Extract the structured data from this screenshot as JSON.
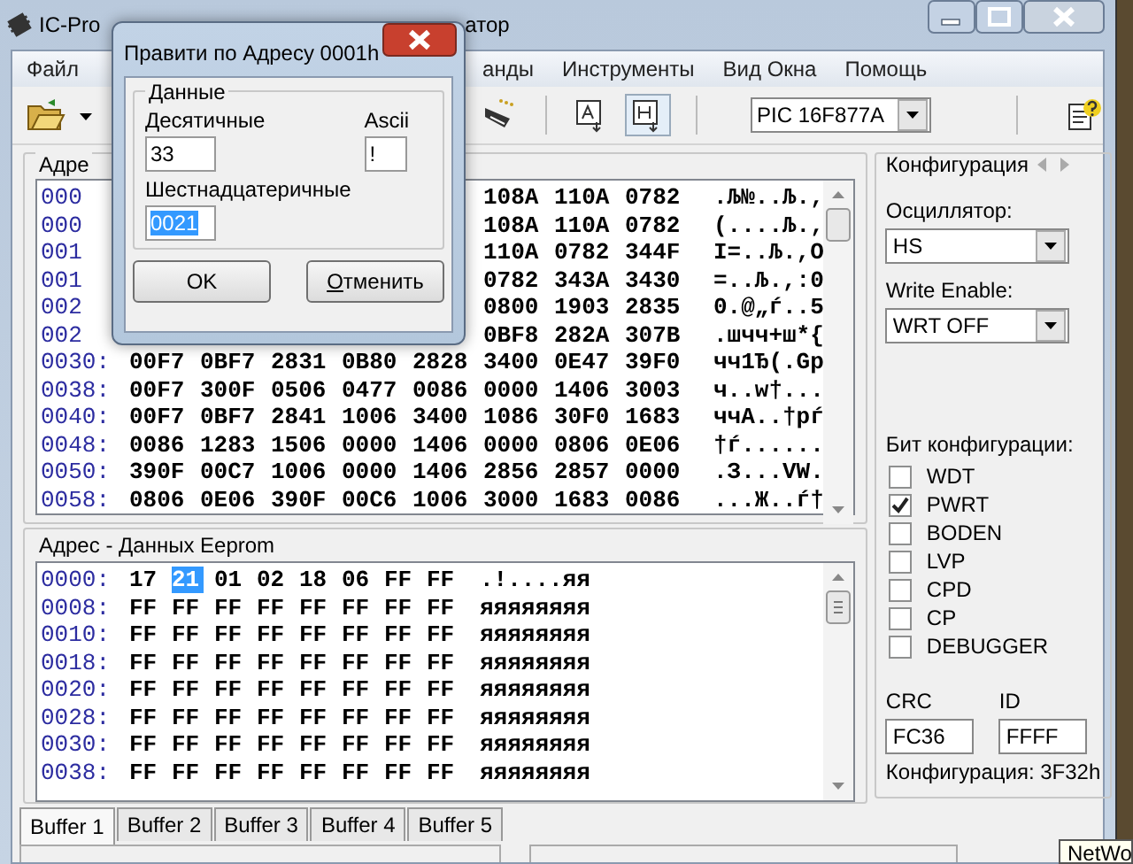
{
  "window": {
    "title_left": "IC-Pro",
    "title_right": "атор"
  },
  "menu": [
    "Файл",
    "анды",
    "Инструменты",
    "Вид Окна",
    "Помощь"
  ],
  "toolbar": {
    "device": "PIC 16F877A"
  },
  "program": {
    "label": "Адре",
    "rows": [
      {
        "address": "000",
        "words": [
          "108A",
          "110A",
          "0782"
        ],
        "ascii": ".Љ№..Љ.,"
      },
      {
        "address": "000",
        "words": [
          "108A",
          "110A",
          "0782"
        ],
        "ascii": "(....Љ.,"
      },
      {
        "address": "001",
        "words": [
          "110A",
          "0782",
          "344F"
        ],
        "ascii": "I=..Љ.,O"
      },
      {
        "address": "001",
        "words": [
          "0782",
          "343A",
          "3430"
        ],
        "ascii": "=..Љ.,:0"
      },
      {
        "address": "002",
        "words": [
          "0800",
          "1903",
          "2835"
        ],
        "ascii": "0.@„ѓ..5"
      },
      {
        "address": "002",
        "words": [
          "0BF8",
          "282A",
          "307B"
        ],
        "ascii": ".шчч+ш*{"
      },
      {
        "address": "0030:",
        "words": [
          "00F7",
          "0BF7",
          "2831",
          "0B80",
          "2828",
          "3400",
          "0E47",
          "39F0"
        ],
        "ascii": "чч1Ђ(.Gp"
      },
      {
        "address": "0038:",
        "words": [
          "00F7",
          "300F",
          "0506",
          "0477",
          "0086",
          "0000",
          "1406",
          "3003"
        ],
        "ascii": "ч..w†..."
      },
      {
        "address": "0040:",
        "words": [
          "00F7",
          "0BF7",
          "2841",
          "1006",
          "3400",
          "1086",
          "30F0",
          "1683"
        ],
        "ascii": "ччA..†pѓ"
      },
      {
        "address": "0048:",
        "words": [
          "0086",
          "1283",
          "1506",
          "0000",
          "1406",
          "0000",
          "0806",
          "0E06"
        ],
        "ascii": "†ѓ......"
      },
      {
        "address": "0050:",
        "words": [
          "390F",
          "00C7",
          "1006",
          "0000",
          "1406",
          "2856",
          "2857",
          "0000"
        ],
        "ascii": ".З...VW."
      },
      {
        "address": "0058:",
        "words": [
          "0806",
          "0E06",
          "390F",
          "00C6",
          "1006",
          "3000",
          "1683",
          "0086"
        ],
        "ascii": "...Ж..ѓ†"
      }
    ]
  },
  "eeprom": {
    "label": "Адрес - Данных Eeprom",
    "rows": [
      {
        "address": "0000:",
        "bytes": [
          {
            "v": "17",
            "selected": false
          },
          {
            "v": "21",
            "selected": true
          },
          {
            "v": "01",
            "selected": false
          },
          {
            "v": "02",
            "selected": false
          },
          {
            "v": "18",
            "selected": false
          },
          {
            "v": "06",
            "selected": false
          },
          {
            "v": "FF",
            "selected": false
          },
          {
            "v": "FF",
            "selected": false
          }
        ],
        "ascii": ".!....яя"
      },
      {
        "address": "0008:",
        "bytes": [
          {
            "v": "FF",
            "selected": false
          },
          {
            "v": "FF",
            "selected": false
          },
          {
            "v": "FF",
            "selected": false
          },
          {
            "v": "FF",
            "selected": false
          },
          {
            "v": "FF",
            "selected": false
          },
          {
            "v": "FF",
            "selected": false
          },
          {
            "v": "FF",
            "selected": false
          },
          {
            "v": "FF",
            "selected": false
          }
        ],
        "ascii": "яяяяяяяя"
      },
      {
        "address": "0010:",
        "bytes": [
          {
            "v": "FF",
            "selected": false
          },
          {
            "v": "FF",
            "selected": false
          },
          {
            "v": "FF",
            "selected": false
          },
          {
            "v": "FF",
            "selected": false
          },
          {
            "v": "FF",
            "selected": false
          },
          {
            "v": "FF",
            "selected": false
          },
          {
            "v": "FF",
            "selected": false
          },
          {
            "v": "FF",
            "selected": false
          }
        ],
        "ascii": "яяяяяяяя"
      },
      {
        "address": "0018:",
        "bytes": [
          {
            "v": "FF",
            "selected": false
          },
          {
            "v": "FF",
            "selected": false
          },
          {
            "v": "FF",
            "selected": false
          },
          {
            "v": "FF",
            "selected": false
          },
          {
            "v": "FF",
            "selected": false
          },
          {
            "v": "FF",
            "selected": false
          },
          {
            "v": "FF",
            "selected": false
          },
          {
            "v": "FF",
            "selected": false
          }
        ],
        "ascii": "яяяяяяяя"
      },
      {
        "address": "0020:",
        "bytes": [
          {
            "v": "FF",
            "selected": false
          },
          {
            "v": "FF",
            "selected": false
          },
          {
            "v": "FF",
            "selected": false
          },
          {
            "v": "FF",
            "selected": false
          },
          {
            "v": "FF",
            "selected": false
          },
          {
            "v": "FF",
            "selected": false
          },
          {
            "v": "FF",
            "selected": false
          },
          {
            "v": "FF",
            "selected": false
          }
        ],
        "ascii": "яяяяяяяя"
      },
      {
        "address": "0028:",
        "bytes": [
          {
            "v": "FF",
            "selected": false
          },
          {
            "v": "FF",
            "selected": false
          },
          {
            "v": "FF",
            "selected": false
          },
          {
            "v": "FF",
            "selected": false
          },
          {
            "v": "FF",
            "selected": false
          },
          {
            "v": "FF",
            "selected": false
          },
          {
            "v": "FF",
            "selected": false
          },
          {
            "v": "FF",
            "selected": false
          }
        ],
        "ascii": "яяяяяяяя"
      },
      {
        "address": "0030:",
        "bytes": [
          {
            "v": "FF",
            "selected": false
          },
          {
            "v": "FF",
            "selected": false
          },
          {
            "v": "FF",
            "selected": false
          },
          {
            "v": "FF",
            "selected": false
          },
          {
            "v": "FF",
            "selected": false
          },
          {
            "v": "FF",
            "selected": false
          },
          {
            "v": "FF",
            "selected": false
          },
          {
            "v": "FF",
            "selected": false
          }
        ],
        "ascii": "яяяяяяяя"
      },
      {
        "address": "0038:",
        "bytes": [
          {
            "v": "FF",
            "selected": false
          },
          {
            "v": "FF",
            "selected": false
          },
          {
            "v": "FF",
            "selected": false
          },
          {
            "v": "FF",
            "selected": false
          },
          {
            "v": "FF",
            "selected": false
          },
          {
            "v": "FF",
            "selected": false
          },
          {
            "v": "FF",
            "selected": false
          },
          {
            "v": "FF",
            "selected": false
          }
        ],
        "ascii": "яяяяяяяя"
      }
    ]
  },
  "config": {
    "title": "Конфигурация",
    "oscillator_label": "Осциллятор:",
    "oscillator": "HS",
    "write_enable_label": "Write Enable:",
    "write_enable": "WRT OFF",
    "bits_label": "Бит конфигурации:",
    "bits": [
      {
        "label": "WDT",
        "checked": false
      },
      {
        "label": "PWRT",
        "checked": true
      },
      {
        "label": "BODEN",
        "checked": false
      },
      {
        "label": "LVP",
        "checked": false
      },
      {
        "label": "CPD",
        "checked": false
      },
      {
        "label": "CP",
        "checked": false
      },
      {
        "label": "DEBUGGER",
        "checked": false
      }
    ],
    "crc_label": "CRC",
    "crc": "FC36",
    "id_label": "ID",
    "id": "FFFF",
    "config_word": "Конфигурация: 3F32h"
  },
  "tabs": [
    {
      "label": "Buffer 1",
      "selected": true
    },
    {
      "label": "Buffer 2",
      "selected": false
    },
    {
      "label": "Buffer 3",
      "selected": false
    },
    {
      "label": "Buffer 4",
      "selected": false
    },
    {
      "label": "Buffer 5",
      "selected": false
    }
  ],
  "dialog": {
    "title": "Правити по Адресу 0001h",
    "group": "Данные",
    "decimal_label": "Десятичные",
    "decimal": "33",
    "ascii_label": "Ascii",
    "ascii": "!",
    "hex_label": "Шестнадцатеричные",
    "hex": "0021",
    "ok": "OK",
    "cancel": "Отменить"
  },
  "tooltip": "NetWo"
}
